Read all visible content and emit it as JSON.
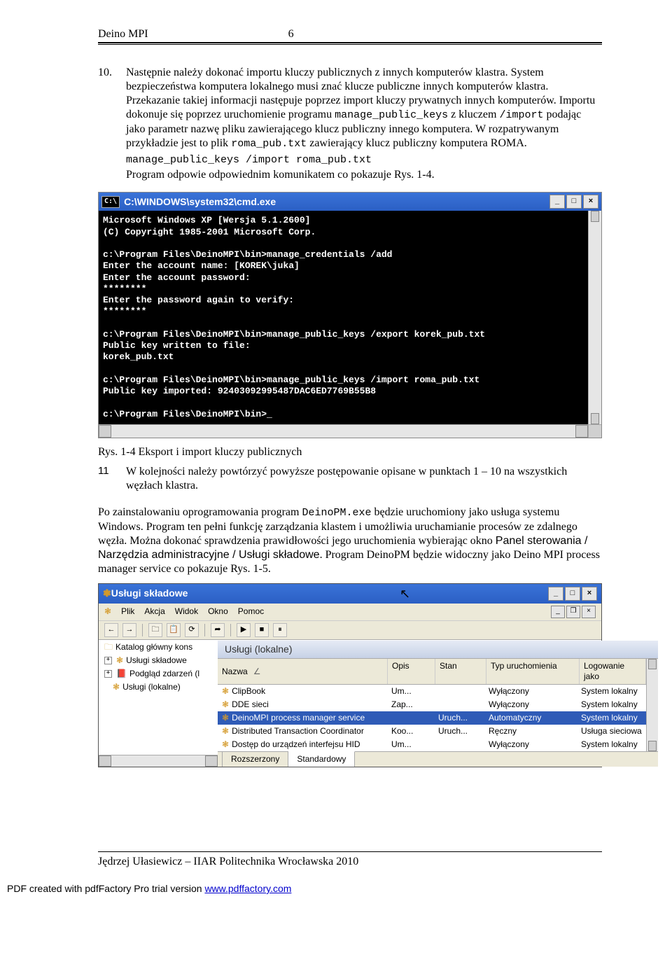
{
  "header": {
    "title": "Deino MPI",
    "page": "6"
  },
  "item10": {
    "num": "10.",
    "p1": "Następnie należy dokonać importu kluczy publicznych z innych komputerów klastra. System bezpieczeństwa komputera lokalnego musi znać klucze publiczne innych komputerów klastra. Przekazanie takiej informacji  następuje  poprzez import kluczy prywatnych innych komputerów. Importu dokonuje się poprzez uruchomienie programu ",
    "mono1": "manage_public_keys",
    "p2": " z kluczem ",
    "mono2": "/import",
    "p3": " podając jako parametr nazwę pliku zawierającego klucz publiczny innego komputera. W rozpatrywanym przykładzie jest to plik ",
    "mono3": "roma_pub.txt",
    "p4": " zawierający klucz publiczny komputera ROMA.",
    "cmd": "manage_public_keys /import roma_pub.txt",
    "p5": "Program odpowie odpowiednim komunikatem co pokazuje Rys. 1-4."
  },
  "cmd_window": {
    "title": "C:\\WINDOWS\\system32\\cmd.exe",
    "lines": "Microsoft Windows XP [Wersja 5.1.2600]\n(C) Copyright 1985-2001 Microsoft Corp.\n\nc:\\Program Files\\DeinoMPI\\bin>manage_credentials /add\nEnter the account name: [KOREK\\juka]\nEnter the account password:\n********\nEnter the password again to verify:\n********\n\nc:\\Program Files\\DeinoMPI\\bin>manage_public_keys /export korek_pub.txt\nPublic key written to file:\nkorek_pub.txt\n\nc:\\Program Files\\DeinoMPI\\bin>manage_public_keys /import roma_pub.txt\nPublic key imported: 92403092995487DAC6ED7769B55B8\n\nc:\\Program Files\\DeinoMPI\\bin>_"
  },
  "caption1": "Rys. 1-4 Eksport i import kluczy publicznych",
  "item11": {
    "num": "11",
    "text": "W kolejności należy powtórzyć powyższe postępowanie opisane w punktach 1 – 10 na wszystkich węzłach klastra."
  },
  "para2": {
    "p1": "Po zainstalowaniu oprogramowania program ",
    "mono1": "DeinoPM.exe",
    "p2": " będzie uruchomiony jako usługa systemu Windows. Program ten pełni funkcję zarządzania klastem i umożliwia uruchamianie procesów ze zdalnego węzła. Można dokonać sprawdzenia prawidłowości jego uruchomienia  wybierając okno ",
    "sans1": "Panel sterowania / Narzędzia administracyjne  / Usługi składowe",
    "p3": ". Program DeinoPM będzie widoczny jako Deino MPI process manager service co pokazuje Rys. 1-5."
  },
  "svc": {
    "title": "Usługi składowe",
    "menu": [
      "Plik",
      "Akcja",
      "Widok",
      "Okno",
      "Pomoc"
    ],
    "tree": [
      {
        "icon": "folder",
        "label": "Katalog główny kons"
      },
      {
        "icon": "plus-gear",
        "label": "Usługi składowe"
      },
      {
        "icon": "plus-book",
        "label": "Podgląd zdarzeń (l"
      },
      {
        "icon": "gear",
        "label": "Usługi (lokalne)"
      }
    ],
    "heading": "Usługi (lokalne)",
    "columns": [
      "Nazwa",
      "Opis",
      "Stan",
      "Typ uruchomienia",
      "Logowanie jako"
    ],
    "rows": [
      {
        "name": "ClipBook",
        "desc": "Um...",
        "status": "",
        "start": "Wyłączony",
        "logon": "System lokalny",
        "sel": false
      },
      {
        "name": "DDE sieci",
        "desc": "Zap...",
        "status": "",
        "start": "Wyłączony",
        "logon": "System lokalny",
        "sel": false
      },
      {
        "name": "DeinoMPI process manager service",
        "desc": "",
        "status": "Uruch...",
        "start": "Automatyczny",
        "logon": "System lokalny",
        "sel": true
      },
      {
        "name": "Distributed Transaction Coordinator",
        "desc": "Koo...",
        "status": "Uruch...",
        "start": "Ręczny",
        "logon": "Usługa sieciowa",
        "sel": false
      },
      {
        "name": "Dostęp do urządzeń interfejsu HID",
        "desc": "Um...",
        "status": "",
        "start": "Wyłączony",
        "logon": "System lokalny",
        "sel": false
      }
    ],
    "tabs": [
      "Rozszerzony",
      "Standardowy"
    ]
  },
  "footer": {
    "text": "Jędrzej Ułasiewicz – IIAR Politechnika Wrocławska      2010"
  },
  "pdf": {
    "text": "PDF created with pdfFactory Pro trial version ",
    "link": "www.pdffactory.com"
  }
}
